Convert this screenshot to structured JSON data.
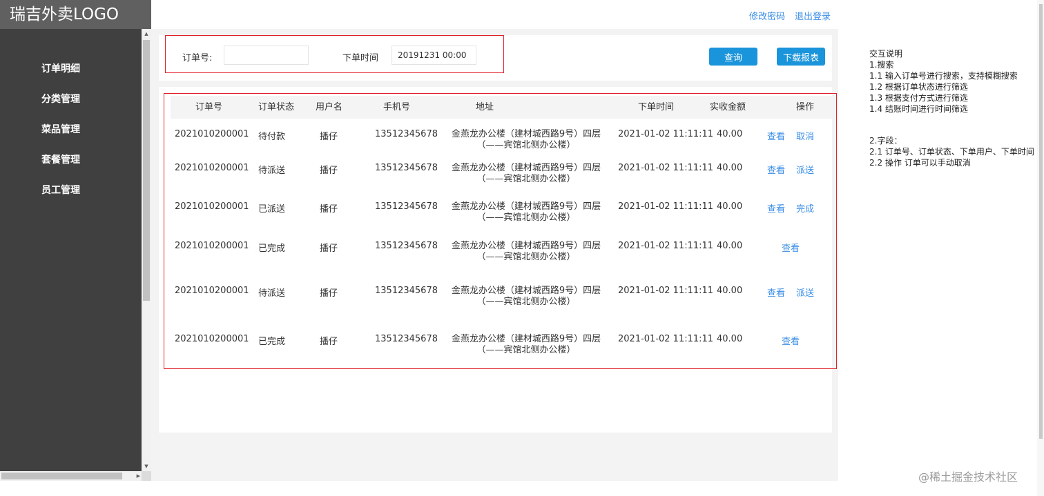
{
  "app": {
    "logo_text": "瑞吉外卖LOGO"
  },
  "sidebar": {
    "items": [
      {
        "label": "订单明细"
      },
      {
        "label": "分类管理"
      },
      {
        "label": "菜品管理"
      },
      {
        "label": "套餐管理"
      },
      {
        "label": "员工管理"
      }
    ]
  },
  "header": {
    "change_password": "修改密码",
    "logout": "退出登录"
  },
  "search": {
    "order_no_label": "订单号:",
    "order_no_value": "",
    "order_time_label": "下单时间",
    "order_time_value": "20191231 00:00",
    "query_button": "查询",
    "download_button": "下载报表"
  },
  "table": {
    "columns": [
      "订单号",
      "订单状态",
      "用户名",
      "手机号",
      "地址",
      "下单时间",
      "实收金额",
      "操作"
    ],
    "rows": [
      {
        "order_no": "2021010200001",
        "status": "待付款",
        "user": "播仔",
        "phone": "13512345678",
        "address_line1": "金燕龙办公楼（建材城西路9号）四层",
        "address_line2": "（——宾馆北侧办公楼）",
        "time": "2021-01-02 11:11:11",
        "amount": "40.00",
        "op1": "查看",
        "op2": "取消"
      },
      {
        "order_no": "2021010200001",
        "status": "待派送",
        "user": "播仔",
        "phone": "13512345678",
        "address_line1": "金燕龙办公楼（建材城西路9号）四层",
        "address_line2": "（——宾馆北侧办公楼）",
        "time": "2021-01-02 11:11:11",
        "amount": "40.00",
        "op1": "查看",
        "op2": "派送"
      },
      {
        "order_no": "2021010200001",
        "status": "已派送",
        "user": "播仔",
        "phone": "13512345678",
        "address_line1": "金燕龙办公楼（建材城西路9号）四层",
        "address_line2": "（——宾馆北侧办公楼）",
        "time": "2021-01-02 11:11:11",
        "amount": "40.00",
        "op1": "查看",
        "op2": "完成"
      },
      {
        "order_no": "2021010200001",
        "status": "已完成",
        "user": "播仔",
        "phone": "13512345678",
        "address_line1": "金燕龙办公楼（建材城西路9号）四层",
        "address_line2": "（——宾馆北侧办公楼）",
        "time": "2021-01-02 11:11:11",
        "amount": "40.00",
        "op1": "查看"
      },
      {
        "order_no": "2021010200001",
        "status": "待派送",
        "user": "播仔",
        "phone": "13512345678",
        "address_line1": "金燕龙办公楼（建材城西路9号）四层",
        "address_line2": "（——宾馆北侧办公楼）",
        "time": "2021-01-02 11:11:11",
        "amount": "40.00",
        "op1": "查看",
        "op2": "派送"
      },
      {
        "order_no": "2021010200001",
        "status": "已完成",
        "user": "播仔",
        "phone": "13512345678",
        "address_line1": "金燕龙办公楼（建材城西路9号）四层",
        "address_line2": "（——宾馆北侧办公楼）",
        "time": "2021-01-02 11:11:11",
        "amount": "40.00",
        "op1": "查看"
      }
    ]
  },
  "notes": {
    "lines_a": [
      "交互说明",
      "1.搜索",
      "1.1 输入订单号进行搜索，支持模糊搜索",
      "1.2 根据订单状态进行筛选",
      "1.3 根据支付方式进行筛选",
      "1.4 结账时间进行时间筛选"
    ],
    "lines_b": [
      "2.字段：",
      "2.1 订单号、订单状态、下单用户、下单时间",
      "2.2 操作 订单可以手动取消"
    ]
  },
  "watermark": "@稀土掘金技术社区",
  "colors": {
    "accent": "#1a94db",
    "link": "#3a8ee6",
    "sidebar": "#404040",
    "highlight": "#e0202a"
  }
}
